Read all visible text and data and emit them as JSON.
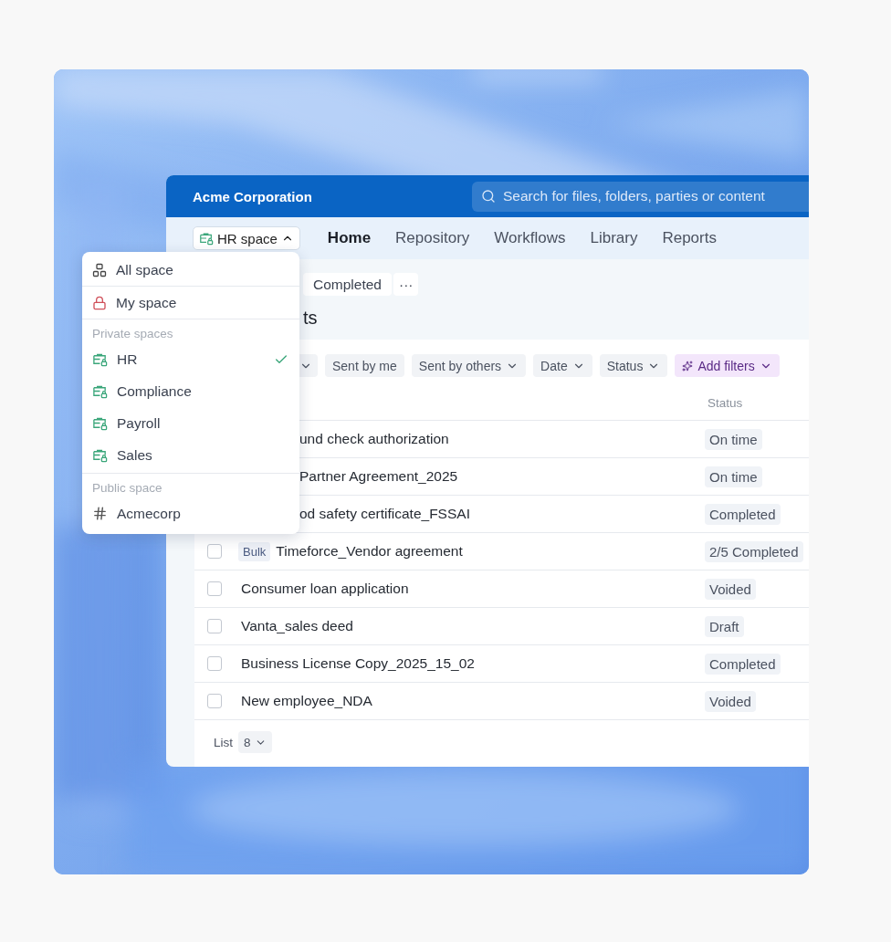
{
  "app": {
    "title": "Acme Corporation",
    "search": {
      "placeholder": "Search for files, folders, parties or content"
    },
    "space_button": {
      "label": "HR space",
      "expanded": true
    },
    "nav": [
      {
        "label": "Home",
        "selected": true
      },
      {
        "label": "Repository",
        "selected": false
      },
      {
        "label": "Workflows",
        "selected": false
      },
      {
        "label": "Library",
        "selected": false
      },
      {
        "label": "Reports",
        "selected": false
      }
    ],
    "tabs": [
      {
        "label": "Completed"
      }
    ],
    "more": "···",
    "heading": "ts",
    "filters": [
      {
        "kind": "cut"
      },
      {
        "kind": "plain",
        "label": "Sent by me"
      },
      {
        "kind": "dropdown",
        "label": "Sent by others"
      },
      {
        "kind": "dropdown",
        "label": "Date"
      },
      {
        "kind": "dropdown",
        "label": "Status"
      },
      {
        "kind": "ai",
        "label": "Add filters"
      }
    ],
    "table": {
      "columns": [
        "Status"
      ],
      "rows": [
        {
          "kind": "covered",
          "name": "und check authorization",
          "status": "On time"
        },
        {
          "kind": "covered",
          "name": "Partner Agreement_2025",
          "status": "On time"
        },
        {
          "kind": "covered",
          "name": "od safety certificate_FSSAI",
          "status": "Completed"
        },
        {
          "kind": "row",
          "checked": false,
          "badge": "Bulk",
          "name": "Timeforce_Vendor agreement",
          "status": "2/5 Completed"
        },
        {
          "kind": "row",
          "checked": false,
          "name": "Consumer loan application",
          "status": "Voided"
        },
        {
          "kind": "row",
          "checked": false,
          "name": "Vanta_sales deed",
          "status": "Draft"
        },
        {
          "kind": "row",
          "checked": false,
          "name": "Business License Copy_2025_15_02",
          "status": "Completed"
        },
        {
          "kind": "row",
          "checked": false,
          "name": "New employee_NDA",
          "status": "Voided"
        }
      ]
    },
    "pagination": {
      "label": "List",
      "value": "8"
    }
  },
  "space_menu": {
    "groups": [
      {
        "items": [
          {
            "kind": "all",
            "label": "All space",
            "selected": false
          },
          {
            "kind": "mine",
            "label": "My space",
            "selected": false
          }
        ]
      },
      {
        "title": "Private spaces",
        "items": [
          {
            "kind": "private",
            "label": "HR",
            "selected": true
          },
          {
            "kind": "private",
            "label": "Compliance",
            "selected": false
          },
          {
            "kind": "private",
            "label": "Payroll",
            "selected": false
          },
          {
            "kind": "private",
            "label": "Sales",
            "selected": false
          }
        ]
      },
      {
        "title": "Public space",
        "items": [
          {
            "kind": "public",
            "label": "Acmecorp",
            "selected": false
          }
        ]
      }
    ]
  }
}
